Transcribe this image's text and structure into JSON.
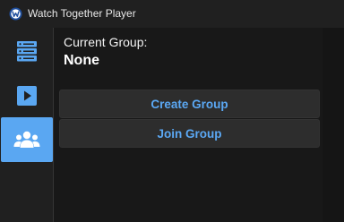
{
  "window": {
    "title": "Watch Together Player",
    "app_icon": "app-logo-icon"
  },
  "sidebar": {
    "items": [
      {
        "name": "servers",
        "icon": "server-stack-icon",
        "active": false
      },
      {
        "name": "player",
        "icon": "play-icon",
        "active": false
      },
      {
        "name": "groups",
        "icon": "people-icon",
        "active": true
      }
    ]
  },
  "main": {
    "current_group_label": "Current Group:",
    "current_group_value": "None",
    "create_group_label": "Create Group",
    "join_group_label": "Join Group"
  },
  "colors": {
    "accent": "#5aa7f2",
    "button_text": "#5ba8f4",
    "button_bg": "#2d2d2d",
    "background": "#181818"
  }
}
